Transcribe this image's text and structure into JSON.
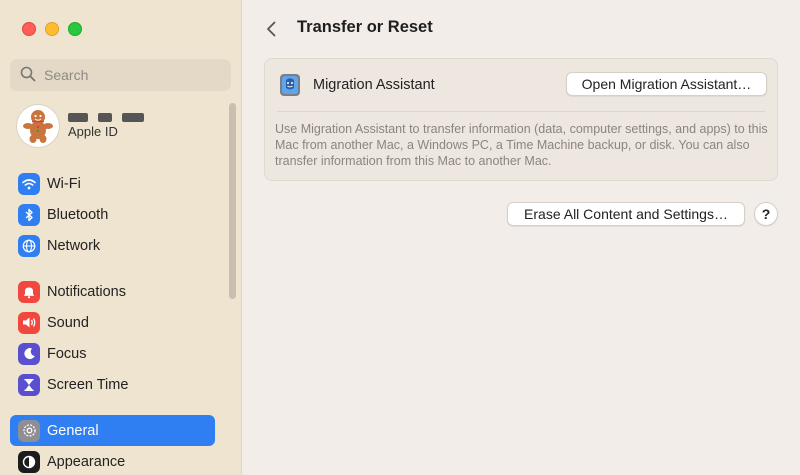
{
  "window": {
    "title": "Transfer or Reset"
  },
  "sidebar": {
    "search": {
      "placeholder": "Search",
      "icon": "search-icon"
    },
    "profile": {
      "name_redacted": true,
      "subtitle": "Apple ID",
      "avatar_icon": "gingerbread-avatar"
    },
    "groups": [
      {
        "items": [
          {
            "label": "Wi-Fi",
            "icon": "wifi-icon",
            "color": "#2f7ff2"
          },
          {
            "label": "Bluetooth",
            "icon": "bluetooth-icon",
            "color": "#2f7ff2"
          },
          {
            "label": "Network",
            "icon": "globe-icon",
            "color": "#2f7ff2"
          }
        ]
      },
      {
        "items": [
          {
            "label": "Notifications",
            "icon": "bell-icon",
            "color": "#f0483e"
          },
          {
            "label": "Sound",
            "icon": "speaker-icon",
            "color": "#f0483e"
          },
          {
            "label": "Focus",
            "icon": "moon-icon",
            "color": "#5a4fcf"
          },
          {
            "label": "Screen Time",
            "icon": "hourglass-icon",
            "color": "#5a4fcf"
          }
        ]
      },
      {
        "items": [
          {
            "label": "General",
            "icon": "gear-icon",
            "color": "#8e8e93",
            "active": true
          },
          {
            "label": "Appearance",
            "icon": "appearance-icon",
            "color": "#1c1c1e"
          }
        ]
      }
    ]
  },
  "main": {
    "back_icon": "chevron-left-icon",
    "title": "Transfer or Reset",
    "migration": {
      "label": "Migration Assistant",
      "button": "Open Migration Assistant…",
      "description": "Use Migration Assistant to transfer information (data, computer settings, and apps) to this Mac from another Mac, a Windows PC, a Time Machine backup, or disk. You can also transfer information from this Mac to another Mac."
    },
    "erase_button": "Erase All Content and Settings…",
    "help_label": "?"
  },
  "colors": {
    "accent": "#2f7ff2",
    "sidebar_bg": "#efe4cf",
    "main_bg": "#f2ede8"
  }
}
